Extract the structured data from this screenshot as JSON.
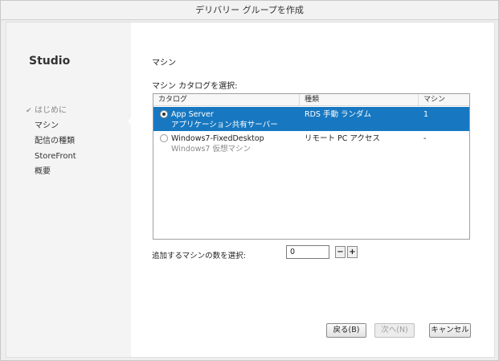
{
  "window": {
    "title": "デリバリー グループを作成"
  },
  "sidebar": {
    "app_title": "Studio",
    "steps": [
      {
        "label": "はじめに",
        "state": "done"
      },
      {
        "label": "マシン",
        "state": "active"
      },
      {
        "label": "配信の種類",
        "state": "pending"
      },
      {
        "label": "StoreFront",
        "state": "pending"
      },
      {
        "label": "概要",
        "state": "pending"
      }
    ]
  },
  "main": {
    "page_title": "マシン",
    "section_label": "マシン カタログを選択:",
    "columns": [
      "カタログ",
      "種類",
      "マシン"
    ],
    "rows": [
      {
        "name": "App Server",
        "description": "アプリケーション共有サーバー",
        "type": "RDS 手動 ランダム",
        "machines": "1",
        "selected": true
      },
      {
        "name": "Windows7-FixedDesktop",
        "description": "Windows7 仮想マシン",
        "type": "リモート PC アクセス",
        "machines": "-",
        "selected": false
      }
    ],
    "count_label": "追加するマシンの数を選択:",
    "count_value": "0",
    "minus_label": "−",
    "plus_label": "+"
  },
  "footer": {
    "back_label": "戻る(B)",
    "next_label": "次へ(N)",
    "cancel_label": "キャンセル"
  },
  "colors": {
    "selection": "#1778c1",
    "sidebar_bg": "#f4f4f4"
  }
}
